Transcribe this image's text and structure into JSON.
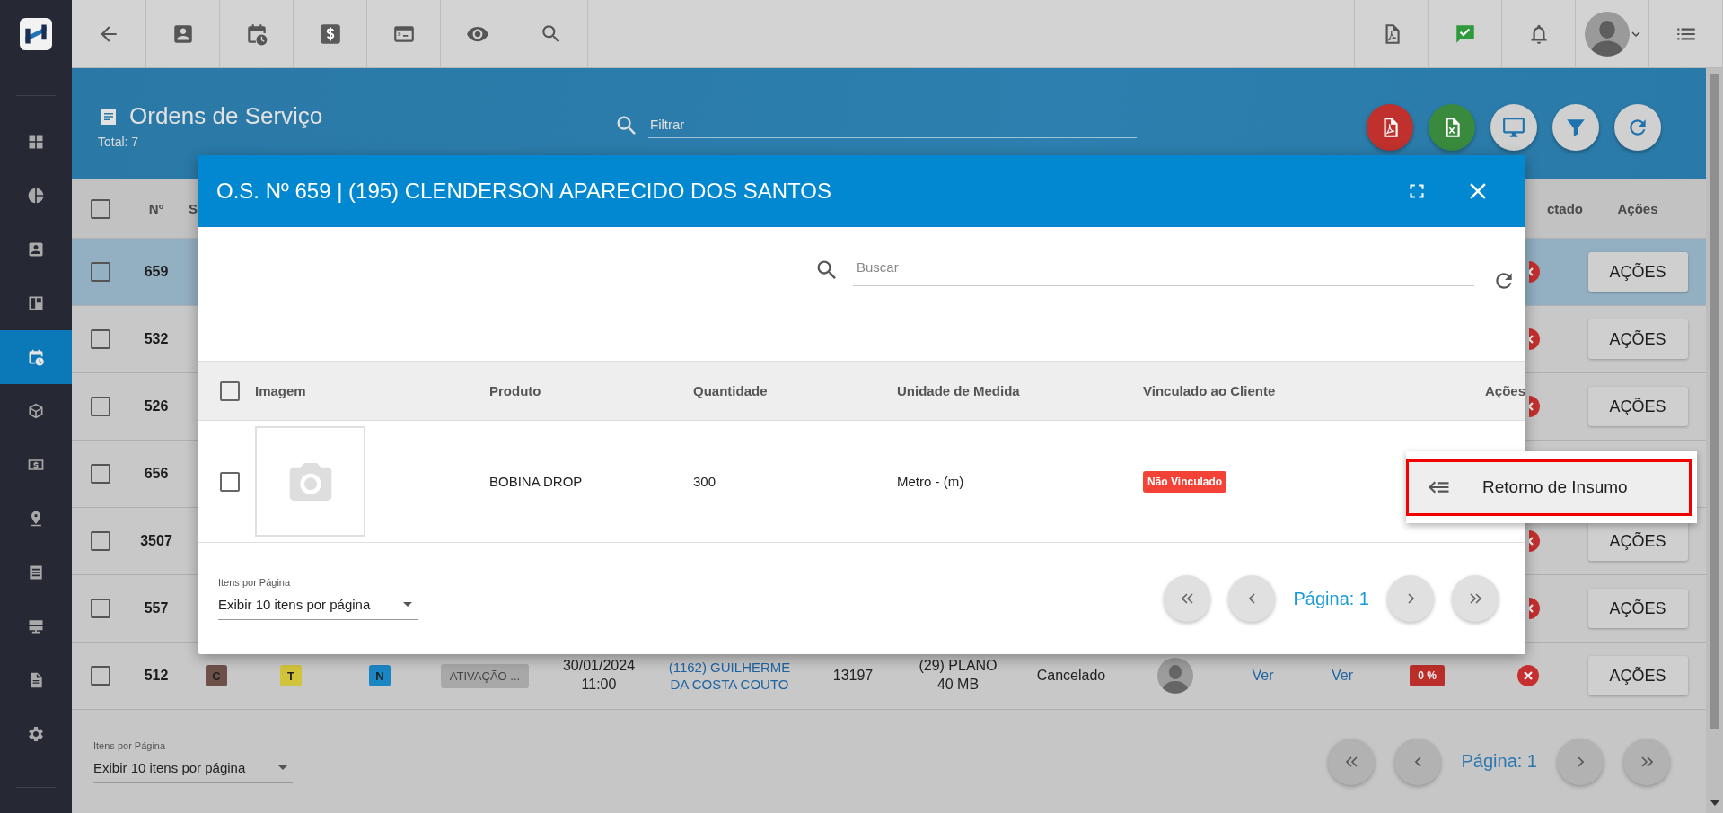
{
  "sidebar": {
    "items": [
      {
        "selected": false
      },
      {
        "selected": false
      },
      {
        "selected": false
      },
      {
        "selected": false
      },
      {
        "selected": true
      },
      {
        "selected": false
      },
      {
        "selected": false
      },
      {
        "selected": false
      },
      {
        "selected": false
      },
      {
        "selected": false
      },
      {
        "selected": false
      },
      {
        "selected": false
      }
    ]
  },
  "page": {
    "title": "Ordens de Serviço",
    "total": "Total: 7",
    "filter_placeholder": "Filtrar"
  },
  "table": {
    "select_all_checked": false,
    "columns": [
      {
        "label": "Nº"
      },
      {
        "label": "S"
      },
      {
        "label": "ctado"
      },
      {
        "label": "Ações"
      }
    ],
    "rows": [
      {
        "number": "659",
        "selected": true,
        "checked": false,
        "action": "AÇÕES"
      },
      {
        "number": "532",
        "selected": false,
        "checked": false,
        "action": "AÇÕES"
      },
      {
        "number": "526",
        "selected": false,
        "checked": false,
        "action": "AÇÕES"
      },
      {
        "number": "656",
        "selected": false,
        "checked": false
      },
      {
        "number": "3507",
        "selected": false,
        "checked": false,
        "action": "AÇÕES"
      },
      {
        "number": "557",
        "selected": false,
        "checked": false,
        "action": "AÇÕES"
      },
      {
        "number": "512",
        "selected": false,
        "checked": false,
        "tags": [
          {
            "label": "C",
            "color": "#6d5149"
          },
          {
            "label": "T",
            "color": "#d2c43a"
          },
          {
            "label": "N",
            "color": "#1a86c4"
          }
        ],
        "status": "ATIVAÇÃO ...",
        "date": "30/01/2024",
        "time": "11:00",
        "client": "(1162) GUILHERME DA COSTA COUTO",
        "code": "13197",
        "plan": "(29) PLANO 40 MB",
        "state": "Cancelado",
        "link_1": "Ver",
        "link_2": "Ver",
        "progress": "0 %",
        "action": "AÇÕES"
      }
    ]
  },
  "footer": {
    "per_page_label": "Itens por Página",
    "per_page": "Exibir 10 itens por página",
    "page": "Página: 1"
  },
  "modal": {
    "title": "O.S. Nº 659 | (195) CLENDERSON APARECIDO DOS SANTOS",
    "search_placeholder": "Buscar",
    "select_all_checked": false,
    "columns": [
      {
        "label": "Imagem"
      },
      {
        "label": "Produto"
      },
      {
        "label": "Quantidade"
      },
      {
        "label": "Unidade de Medida"
      },
      {
        "label": "Vinculado ao Cliente"
      },
      {
        "label": "Ações"
      }
    ],
    "rows": [
      {
        "checked": false,
        "product": "BOBINA DROP",
        "quantity": "300",
        "unit": "Metro - (m)",
        "linked": false,
        "linked_label": "Não Vinculado"
      }
    ],
    "per_page_label": "Itens por Página",
    "per_page": "Exibir 10 itens por página",
    "page": "Página: 1"
  },
  "menu": {
    "items": [
      {
        "label": "Retorno de Insumo",
        "highlighted": true
      }
    ]
  }
}
